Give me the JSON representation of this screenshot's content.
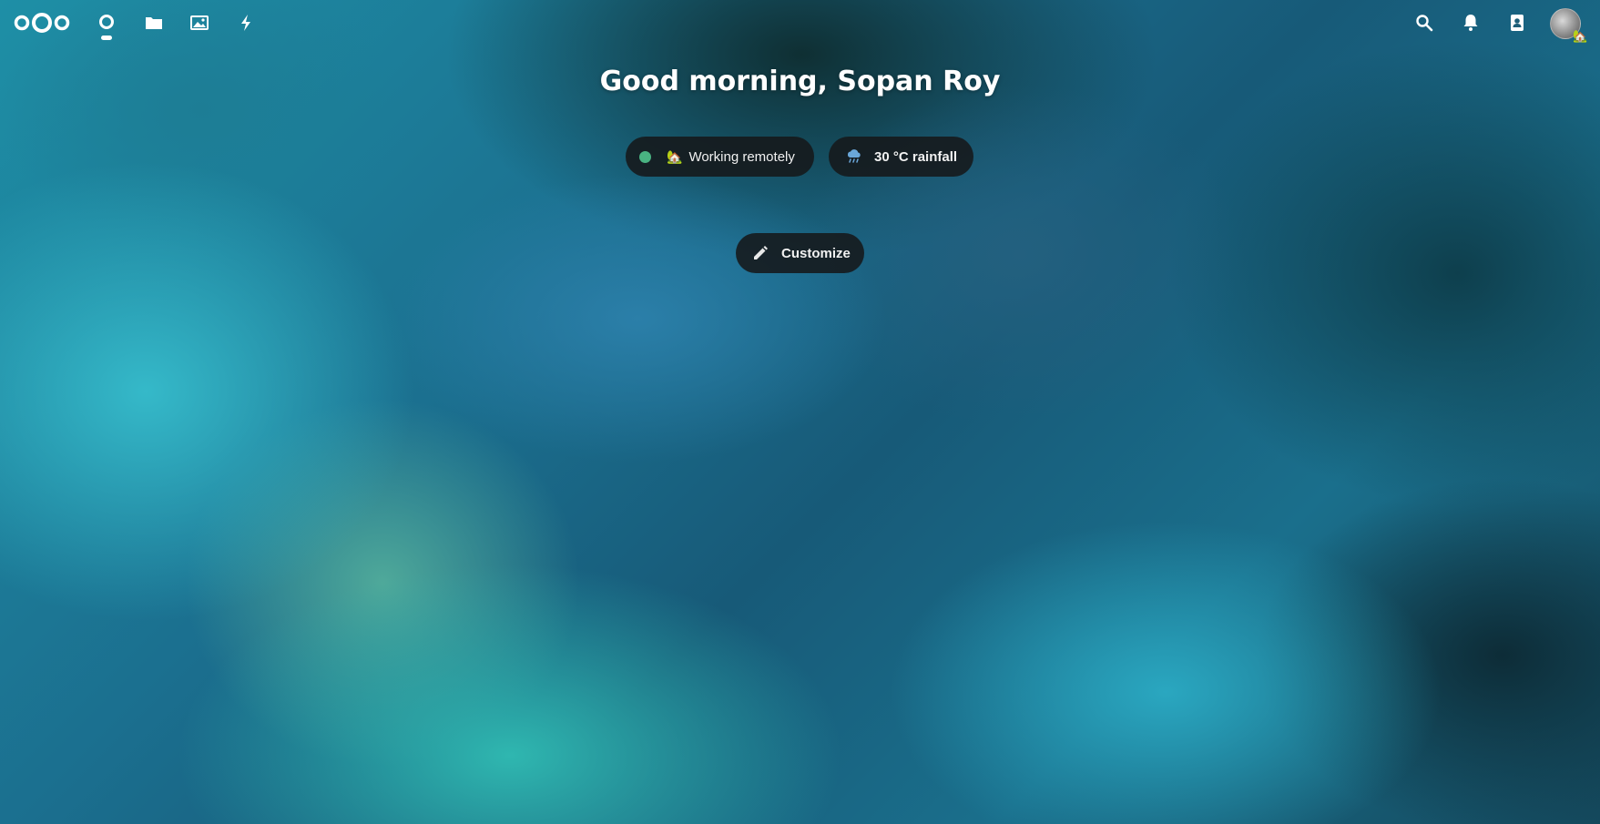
{
  "header": {
    "logo": "nextcloud-logo",
    "nav": [
      {
        "name": "dashboard",
        "icon": "dashboard-icon",
        "active": true
      },
      {
        "name": "files",
        "icon": "folder-icon",
        "active": false
      },
      {
        "name": "photos",
        "icon": "image-icon",
        "active": false
      },
      {
        "name": "activity",
        "icon": "lightning-icon",
        "active": false
      }
    ],
    "right_icons": [
      "search-icon",
      "bell-icon",
      "contacts-icon"
    ],
    "avatar_status_emoji": "🏡"
  },
  "main": {
    "greeting": "Good morning, Sopan Roy",
    "status": {
      "emoji": "🏡",
      "text": "Working remotely",
      "dot_color": "#49b382"
    },
    "weather": {
      "icon": "rain-cloud-icon",
      "text": "30 °C rainfall"
    },
    "customize_label": "Customize"
  },
  "colors": {
    "pill_bg": "#16181a",
    "text": "#ffffff",
    "online": "#49b382"
  }
}
